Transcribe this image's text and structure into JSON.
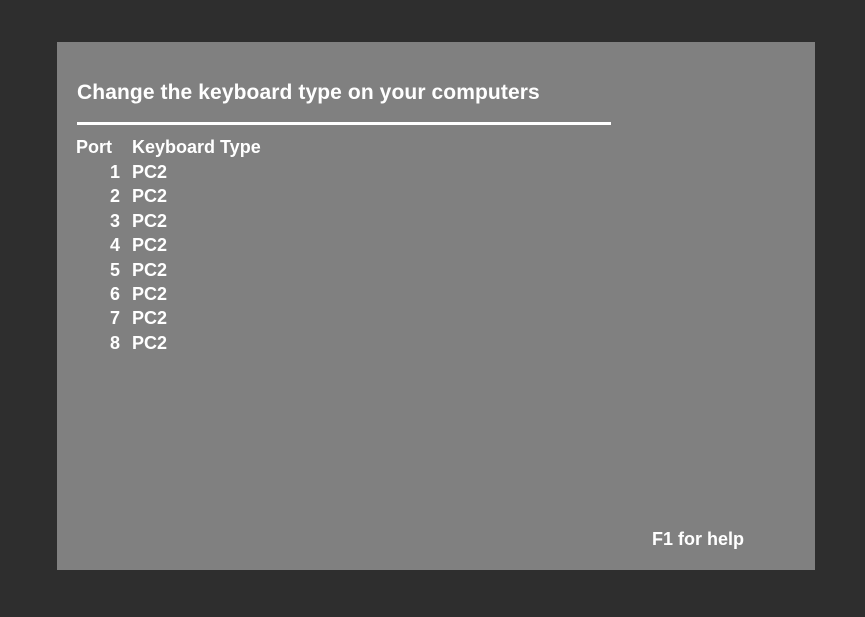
{
  "screen": {
    "title": "Change the keyboard type on your computers",
    "columns": {
      "port": "Port",
      "type": "Keyboard Type"
    },
    "rows": [
      {
        "port": "1",
        "type": "PC2"
      },
      {
        "port": "2",
        "type": "PC2"
      },
      {
        "port": "3",
        "type": "PC2"
      },
      {
        "port": "4",
        "type": "PC2"
      },
      {
        "port": "5",
        "type": "PC2"
      },
      {
        "port": "6",
        "type": "PC2"
      },
      {
        "port": "7",
        "type": "PC2"
      },
      {
        "port": "8",
        "type": "PC2"
      }
    ],
    "help": "F1 for help"
  },
  "colors": {
    "background": "#2e2e2e",
    "panel": "#808080",
    "text": "#ffffff"
  }
}
